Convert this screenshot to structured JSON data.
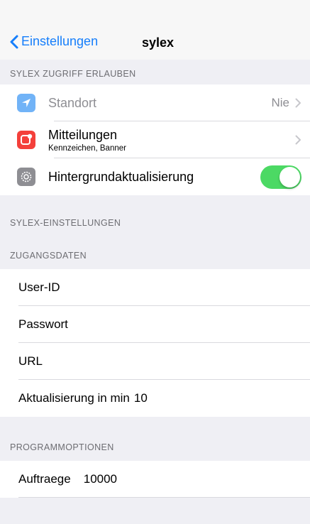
{
  "nav": {
    "back_label": "Einstellungen",
    "title": "sylex"
  },
  "sections": {
    "access_header": "SYLEX ZUGRIFF ERLAUBEN",
    "settings_header": "SYLEX-EINSTELLUNGEN",
    "credentials_header": "ZUGANGSDATEN",
    "program_header": "PROGRAMMOPTIONEN"
  },
  "access": {
    "location_label": "Standort",
    "location_value": "Nie",
    "notifications_label": "Mitteilungen",
    "notifications_sub": "Kennzeichen, Banner",
    "background_label": "Hintergrundaktualisierung",
    "background_enabled": true
  },
  "credentials": {
    "userid_label": "User-ID",
    "userid_value": "",
    "password_label": "Passwort",
    "password_value": "",
    "url_label": "URL",
    "url_value": "",
    "refresh_label": "Aktualisierung in min",
    "refresh_value": "10"
  },
  "program": {
    "orders_label": "Auftraege",
    "orders_value": "10000"
  },
  "colors": {
    "ios_blue": "#157efb",
    "location_icon_bg": "#71b3f7",
    "notifications_icon_bg": "#f4403b",
    "settings_icon_bg": "#8e8e93",
    "toggle_on": "#4cd964"
  },
  "icons": {
    "back": "chevron-left-icon",
    "location": "location-arrow-icon",
    "notifications": "notifications-icon",
    "background": "gear-icon",
    "disclosure": "chevron-right-icon"
  }
}
